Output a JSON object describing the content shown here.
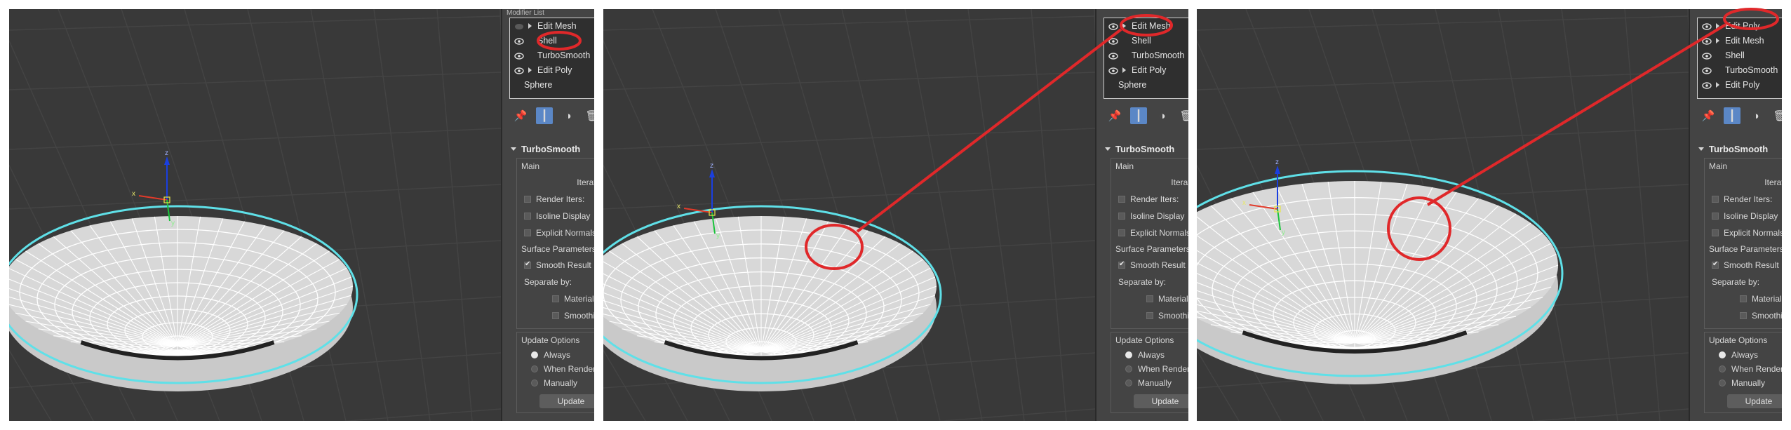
{
  "panels": [
    {
      "stack_header": "Modifier List",
      "stack_items": [
        {
          "label": "Edit Mesh",
          "eye": false,
          "arrow": true
        },
        {
          "label": "Shell",
          "eye": true,
          "arrow": false
        },
        {
          "label": "TurboSmooth",
          "eye": true,
          "arrow": false
        },
        {
          "label": "Edit Poly",
          "eye": true,
          "arrow": true
        },
        {
          "label": "Sphere",
          "eye": false,
          "arrow": false
        }
      ]
    },
    {
      "stack_header": "",
      "stack_items": [
        {
          "label": "Edit Mesh",
          "eye": true,
          "arrow": true
        },
        {
          "label": "Shell",
          "eye": true,
          "arrow": false
        },
        {
          "label": "TurboSmooth",
          "eye": true,
          "arrow": false
        },
        {
          "label": "Edit Poly",
          "eye": true,
          "arrow": true
        },
        {
          "label": "Sphere",
          "eye": false,
          "arrow": false
        }
      ]
    },
    {
      "stack_header": "",
      "stack_items": [
        {
          "label": "Edit Poly",
          "eye": true,
          "arrow": true
        },
        {
          "label": "Edit Mesh",
          "eye": true,
          "arrow": true
        },
        {
          "label": "Shell",
          "eye": true,
          "arrow": false
        },
        {
          "label": "TurboSmooth",
          "eye": true,
          "arrow": false
        },
        {
          "label": "Edit Poly",
          "eye": true,
          "arrow": true
        }
      ]
    }
  ],
  "rollout": {
    "title": "TurboSmooth",
    "main_label": "Main",
    "iterations_label": "Iterations:",
    "render_iters_label": "Render Iters:",
    "isoline_label": "Isoline Display",
    "explicit_normals_label": "Explicit Normals",
    "surface_params_label": "Surface Parameters",
    "smooth_result_label": "Smooth Result",
    "separate_by_label": "Separate by:",
    "materials_label": "Materials",
    "smoothing_label": "Smoothing",
    "update_options_label": "Update Options",
    "always_label": "Always",
    "when_rendering_label": "When Rendering",
    "manually_label": "Manually",
    "update_button_label": "Update"
  },
  "colors": {
    "annotation_red": "#e0282a",
    "selection_cyan": "#5fe0e8",
    "viewport_bg": "#393939",
    "panel_bg": "#444444",
    "active_tool": "#5b87c6"
  },
  "axis_labels": {
    "x": "x",
    "y": "y",
    "z": "z"
  }
}
